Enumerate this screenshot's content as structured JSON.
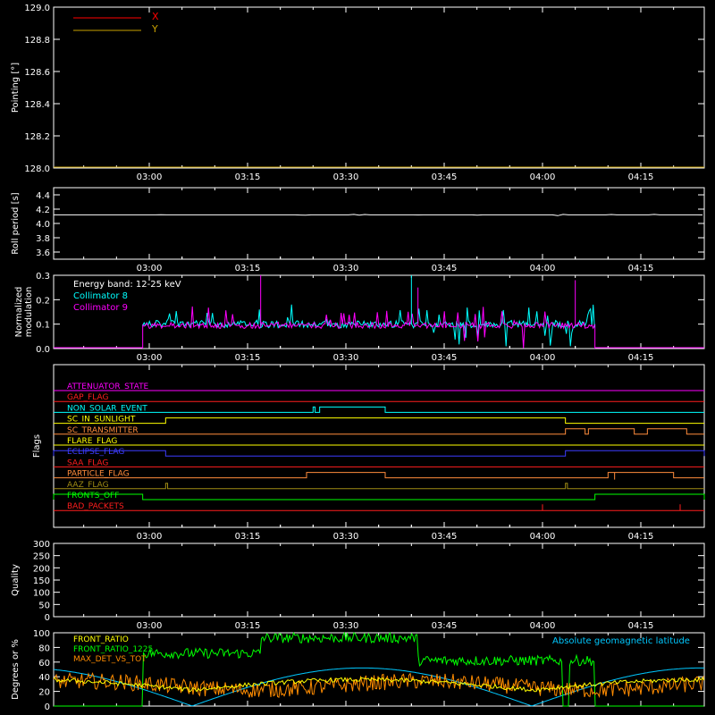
{
  "time_ticks": [
    "03:00",
    "03:15",
    "03:30",
    "03:45",
    "04:00",
    "04:15"
  ],
  "colors": {
    "axis": "#ffffff",
    "background": "#000000",
    "x": "#ff0000",
    "y": "#c8a000",
    "collimator8": "#00ffff",
    "collimator9": "#ff00ff",
    "front_ratio": "#ffff00",
    "front_ratio_1225": "#00ff00",
    "max_det": "#ff8c00",
    "geomag": "#00c8ff"
  },
  "chart_data": [
    {
      "type": "line",
      "ylabel": "Pointing [°]",
      "ylim": [
        128.0,
        129.0
      ],
      "yticks": [
        "128.0",
        "128.2",
        "128.4",
        "128.6",
        "128.8",
        "129.0"
      ],
      "legend": [
        "X",
        "Y"
      ],
      "series": [
        {
          "name": "X",
          "values": []
        },
        {
          "name": "Y",
          "values": []
        }
      ]
    },
    {
      "type": "line",
      "ylabel": "Roll period [s]",
      "ylim": [
        3.5,
        4.5
      ],
      "yticks": [
        "3.6",
        "3.8",
        "4.0",
        "4.2",
        "4.4"
      ],
      "series": [
        {
          "name": "",
          "values": [
            [
              0,
              4.12
            ],
            [
              100,
              4.12
            ]
          ]
        }
      ]
    },
    {
      "type": "line",
      "ylabel": "Normalized modulation",
      "ylim": [
        0,
        0.3
      ],
      "yticks": [
        "0.0",
        "0.1",
        "0.2",
        "0.3"
      ],
      "legend": [
        "Energy band: 12-25 keV",
        "Collimator 8",
        "Collimator 9"
      ],
      "x_range_minutes": [
        "02:53",
        "04:23"
      ],
      "active_range": [
        "02:59",
        "04:08"
      ],
      "typical_value": 0.1
    },
    {
      "type": "table",
      "ylabel": "Flags",
      "flags": [
        {
          "name": "ATTENUATOR_STATE",
          "color": "#ff00ff"
        },
        {
          "name": "GAP_FLAG",
          "color": "#ff1e1e"
        },
        {
          "name": "NON_SOLAR_EVENT",
          "color": "#00ffff"
        },
        {
          "name": "SC_IN_SUNLIGHT",
          "color": "#ffff00"
        },
        {
          "name": "SC_TRANSMITTER",
          "color": "#ff8c3c"
        },
        {
          "name": "FLARE_FLAG",
          "color": "#ffff00"
        },
        {
          "name": "ECLIPSE_FLAG",
          "color": "#3c3cff"
        },
        {
          "name": "SAA_FLAG",
          "color": "#ff1e1e"
        },
        {
          "name": "PARTICLE_FLAG",
          "color": "#ff8c3c"
        },
        {
          "name": "AAZ_FLAG",
          "color": "#a08c14"
        },
        {
          "name": "FRONTS_OFF",
          "color": "#00ff00"
        },
        {
          "name": "BAD_PACKETS",
          "color": "#ff1e1e"
        }
      ]
    },
    {
      "type": "line",
      "ylabel": "Quality",
      "ylim": [
        0,
        300
      ],
      "yticks": [
        "0",
        "50",
        "100",
        "150",
        "200",
        "250",
        "300"
      ],
      "series": []
    },
    {
      "type": "line",
      "ylabel": "Degrees or %",
      "ylim": [
        0,
        100
      ],
      "yticks": [
        "0",
        "20",
        "40",
        "60",
        "80",
        "100"
      ],
      "legend": [
        "FRONT_RATIO",
        "FRONT_RATIO_1225",
        "MAX_DET_VS_TOT",
        "Absolute geomagnetic latitude"
      ]
    }
  ]
}
